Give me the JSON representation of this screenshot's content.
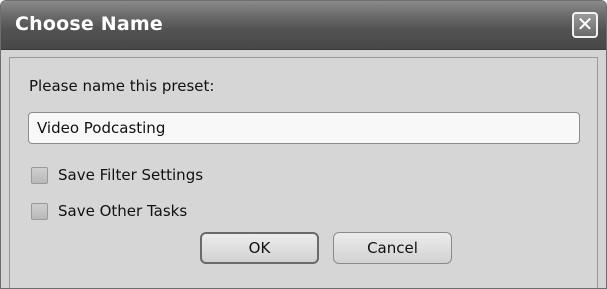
{
  "dialog": {
    "title": "Choose Name",
    "close_glyph": "✕",
    "close_icon": "close-icon"
  },
  "form": {
    "prompt": "Please name this preset:",
    "name_value": "Video Podcasting",
    "checkboxes": [
      {
        "label": "Save Filter Settings",
        "checked": false
      },
      {
        "label": "Save Other Tasks",
        "checked": false
      }
    ]
  },
  "buttons": {
    "ok_label": "OK",
    "cancel_label": "Cancel"
  }
}
